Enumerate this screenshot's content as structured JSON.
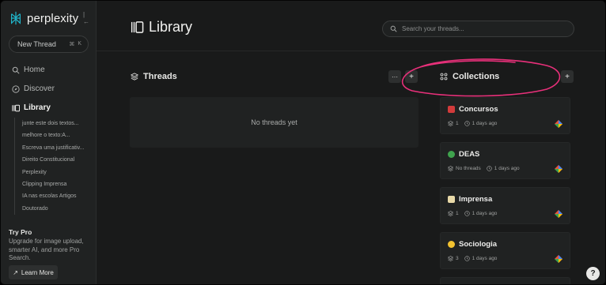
{
  "app": {
    "name": "perplexity"
  },
  "sidebar": {
    "new_thread_label": "New Thread",
    "shortcut_cmd": "⌘",
    "shortcut_key": "K",
    "nav": [
      {
        "label": "Home",
        "icon": "search-icon"
      },
      {
        "label": "Discover",
        "icon": "compass-icon"
      },
      {
        "label": "Library",
        "icon": "library-icon",
        "active": true
      }
    ],
    "library_items": [
      "junte este dois textos...",
      "melhore o texto:A...",
      "Escreva uma justificativ...",
      "Direito Constitucional",
      "Perplexity",
      "Clipping Imprensa",
      "IA nas escolas Artigos",
      "Doutorado"
    ],
    "try_pro_title": "Try Pro",
    "try_pro_text": "Upgrade for image upload, smarter AI, and more Pro Search.",
    "learn_more_label": "Learn More"
  },
  "header": {
    "title": "Library",
    "search_placeholder": "Search your threads..."
  },
  "threads": {
    "title": "Threads",
    "empty_text": "No threads yet",
    "more_label": "···",
    "add_label": "+"
  },
  "collections": {
    "title": "Collections",
    "add_label": "+",
    "items": [
      {
        "name": "Concursos",
        "emoji_color": "#d23b3b",
        "count": "1",
        "time": "1 days ago"
      },
      {
        "name": "DEAS",
        "emoji_color": "#3fa34d",
        "count": "No threads",
        "time": "1 days ago"
      },
      {
        "name": "Imprensa",
        "emoji_color": "#e8d9a8",
        "count": "1",
        "time": "1 days ago"
      },
      {
        "name": "Sociologia",
        "emoji_color": "#f2c230",
        "count": "3",
        "time": "1 days ago"
      }
    ]
  },
  "help_label": "?",
  "colors": {
    "annotation": "#e8307a",
    "accent": "#20b8cd"
  }
}
